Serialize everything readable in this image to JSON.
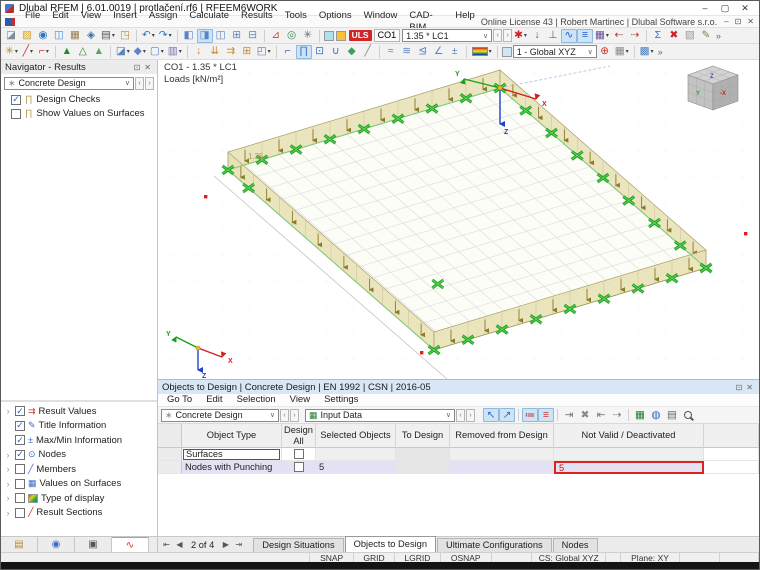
{
  "window": {
    "title": "Dlubal RFEM | 6.01.0019 | protlačení.rf6 | RFEEM6WORK",
    "license_text": "Online License 43 | Robert Martinec | Dlubal Software s.r.o."
  },
  "glyphs": {
    "minimize": "–",
    "maximize": "▢",
    "close": "✕",
    "pin": "⊡",
    "combo_chevron": "∨",
    "back": "‹",
    "fwd": "›",
    "overflow": "»",
    "nav_first": "⇤",
    "nav_prev": "◀",
    "nav_next": "▶",
    "nav_last": "⇥",
    "combo_leaf": "∗",
    "table_green": "▦"
  },
  "menubar": [
    "File",
    "Edit",
    "View",
    "Insert",
    "Assign",
    "Calculate",
    "Results",
    "Tools",
    "Options",
    "Window",
    "CAD-BIM",
    "Help"
  ],
  "toolbar1": {
    "uls": "ULS",
    "co": "CO1",
    "combo_value": "1.35 * LC1",
    "swatch1": "#aee0f0",
    "swatch2": "#f5c23a",
    "left": [
      {
        "name": "import-model-icon",
        "g": "◪",
        "c": "#7a8ca0"
      },
      {
        "name": "open-file-icon",
        "g": "▨",
        "c": "#d8a21d"
      },
      {
        "name": "sync-model-icon",
        "g": "◉",
        "c": "#2f74c0"
      },
      {
        "name": "copy-icon",
        "g": "◫",
        "c": "#4a90d9"
      },
      {
        "name": "archive-icon",
        "g": "▦",
        "c": "#9a7b4f"
      },
      {
        "name": "save-icon",
        "g": "◈",
        "c": "#3a6ea5"
      },
      {
        "name": "print-icon",
        "g": "▤",
        "c": "#555555",
        "dd": true
      },
      {
        "name": "paste-icon",
        "g": "◳",
        "c": "#b58b3a"
      },
      "|",
      {
        "name": "undo-icon",
        "g": "↶",
        "c": "#2f74c0",
        "dd": true
      },
      {
        "name": "redo-icon",
        "g": "↷",
        "c": "#2f74c0",
        "dd": true
      },
      "|",
      {
        "name": "navigator-toggle-icon",
        "g": "◧",
        "c": "#5b84c4"
      },
      {
        "name": "tables-toggle-icon",
        "g": "◨",
        "c": "#5b84c4",
        "t": true
      },
      {
        "name": "panel-toggle-icon",
        "g": "◫",
        "c": "#5b84c4"
      },
      {
        "name": "dual-view-icon",
        "g": "⊞",
        "c": "#5b84c4"
      },
      {
        "name": "table-view-icon",
        "g": "⊟",
        "c": "#5b84c4"
      },
      "|",
      {
        "name": "select-objects-icon",
        "g": "⊿",
        "c": "#c04a3a"
      },
      {
        "name": "visibility-states-icon",
        "g": "◎",
        "c": "#3a8a5a"
      },
      {
        "name": "display-settings-icon",
        "g": "✳",
        "c": "#6a6a6a"
      },
      "|"
    ],
    "right": [
      {
        "name": "result-filter-icon",
        "g": "✱",
        "c": "#cc2222",
        "dd": true
      },
      {
        "name": "show-loads-icon",
        "g": "↓",
        "c": "#2a7d2a"
      },
      {
        "name": "show-supports-icon",
        "g": "⊥",
        "c": "#666666"
      },
      {
        "name": "show-results-icon",
        "g": "∿",
        "c": "#2255cc",
        "t": true
      },
      {
        "name": "show-result-values-icon",
        "g": "≡",
        "c": "#2255cc",
        "t": true
      },
      {
        "name": "result-tables-icon",
        "g": "▦",
        "c": "#6a4a9a",
        "dd": true
      },
      {
        "name": "previous-loading-icon",
        "g": "⇠",
        "c": "#c03333"
      },
      {
        "name": "next-loading-icon",
        "g": "⇢",
        "c": "#c03333"
      },
      "|",
      {
        "name": "calculation-icon",
        "g": "Σ",
        "c": "#3a6bc4"
      },
      {
        "name": "clear-results-icon",
        "g": "✖",
        "c": "#cc2222"
      },
      {
        "name": "render-mode-icon",
        "g": "▧",
        "c": "#999999"
      },
      {
        "name": "edit-mode-icon",
        "g": "✎",
        "c": "#8a7a3a"
      }
    ]
  },
  "toolbar2": {
    "cs_value": "1 - Global XYZ",
    "cs_swatch": "#cfe6f5",
    "left": [
      {
        "name": "new-node-icon",
        "g": "✳",
        "c": "#b58b3a",
        "dd": true
      },
      {
        "name": "new-line-icon",
        "g": "╱",
        "c": "#cc3333",
        "dd": true
      },
      {
        "name": "new-polyline-icon",
        "g": "⌐",
        "c": "#cc3333",
        "dd": true
      },
      "|",
      {
        "name": "new-nodal-support-icon",
        "g": "▲",
        "c": "#2a8a2a"
      },
      {
        "name": "new-line-support-icon",
        "g": "△",
        "c": "#2a8a2a"
      },
      {
        "name": "support-table-icon",
        "g": "▲",
        "c": "#57a857"
      },
      "|",
      {
        "name": "new-surface-icon",
        "g": "◪",
        "c": "#5b84c4",
        "dd": true
      },
      {
        "name": "new-solid-icon",
        "g": "◆",
        "c": "#5b84c4",
        "dd": true
      },
      {
        "name": "new-opening-icon",
        "g": "▢",
        "c": "#5b84c4",
        "dd": true
      },
      {
        "name": "new-section-icon",
        "g": "▥",
        "c": "#7a6ab0",
        "dd": true
      },
      "|",
      {
        "name": "nodal-load-icon",
        "g": "↓",
        "c": "#cc8a2a"
      },
      {
        "name": "member-load-icon",
        "g": "⇊",
        "c": "#cc8a2a"
      },
      {
        "name": "surface-load-icon",
        "g": "⇉",
        "c": "#cc8a2a"
      },
      {
        "name": "free-load-icon",
        "g": "⊞",
        "c": "#cc8a2a"
      },
      {
        "name": "load-wizard-icon",
        "g": "◰",
        "c": "#7a6ab0",
        "dd": true
      },
      "|"
    ],
    "right": [
      {
        "name": "clip-plane-icon",
        "g": "⌐",
        "c": "#3a6bc4"
      },
      {
        "name": "wireframe-icon",
        "g": "∏",
        "c": "#3a6bc4",
        "t": true
      },
      {
        "name": "solid-display-icon",
        "g": "⊡",
        "c": "#3a6bc4"
      },
      {
        "name": "transparent-display-icon",
        "g": "∪",
        "c": "#3a6bc4"
      },
      {
        "name": "render-colors-icon",
        "g": "◆",
        "c": "#3aa05a"
      },
      {
        "name": "view-angle-icon",
        "g": "╱",
        "c": "#888888"
      },
      "|",
      {
        "name": "smooth-results-icon",
        "g": "≈",
        "c": "#5b84c4"
      },
      {
        "name": "hatch-results-icon",
        "g": "≋",
        "c": "#5b84c4"
      },
      {
        "name": "section-results-icon",
        "g": "⊴",
        "c": "#5b84c4"
      },
      {
        "name": "angle-icon",
        "g": "∠",
        "c": "#5b84c4"
      },
      {
        "name": "deform-scale-icon",
        "g": "±",
        "c": "#5b84c4"
      },
      "|",
      {
        "name": "color-scale-icon",
        "grad": true,
        "dd": true
      },
      "|"
    ],
    "right2": [
      {
        "name": "find-cs-icon",
        "g": "⊕",
        "c": "#cc3333"
      },
      {
        "name": "grid-settings-icon",
        "g": "▦",
        "c": "#888888",
        "dd": true
      },
      "|",
      {
        "name": "background-icon",
        "g": "▩",
        "c": "#4a7ebb",
        "dd": true
      }
    ]
  },
  "navigator": {
    "title": "Navigator - Results",
    "combo": "Concrete Design",
    "checks": [
      {
        "label": "Design Checks",
        "checked": true
      },
      {
        "label": "Show Values on Surfaces",
        "checked": false
      }
    ],
    "tree": [
      {
        "label": "Result Values",
        "checked": true,
        "expand": true,
        "glyph": "⇉",
        "color": "#cc3333"
      },
      {
        "label": "Title Information",
        "checked": true,
        "expand": false,
        "glyph": "✎",
        "color": "#3a6bc4"
      },
      {
        "label": "Max/Min Information",
        "checked": true,
        "expand": false,
        "glyph": "±",
        "color": "#3a6bc4"
      },
      {
        "label": "Nodes",
        "checked": true,
        "expand": true,
        "glyph": "⊙",
        "color": "#3a6bc4"
      },
      {
        "label": "Members",
        "checked": false,
        "expand": true,
        "glyph": "╱",
        "color": "#3a6bc4"
      },
      {
        "label": "Values on Surfaces",
        "checked": false,
        "expand": true,
        "glyph": "▦",
        "color": "#3a6bc4"
      },
      {
        "label": "Type of display",
        "checked": false,
        "expand": true,
        "glyph": "rainbow",
        "color": "rainbow"
      },
      {
        "label": "Result Sections",
        "checked": false,
        "expand": true,
        "glyph": "╱",
        "color": "#cc3333"
      }
    ],
    "bottom_tabs": [
      {
        "name": "navigator-data-tab",
        "glyph": "▤",
        "color": "#b5893a",
        "active": false
      },
      {
        "name": "navigator-display-tab",
        "glyph": "◉",
        "color": "#3a6bc4",
        "active": false
      },
      {
        "name": "navigator-views-tab",
        "glyph": "▣",
        "color": "#555555",
        "active": false
      },
      {
        "name": "navigator-results-tab",
        "glyph": "∿",
        "color": "#cc3333",
        "active": true
      }
    ]
  },
  "viewport": {
    "header_line1": "CO1 - 1.35 * LC1",
    "header_line2": "Loads [kN/m²]",
    "wall_load_value": "1.35",
    "axes": {
      "x": "X",
      "y": "Y",
      "z": "Z"
    },
    "cube": {
      "top": "Z",
      "left": "Y",
      "right": "-X"
    }
  },
  "panel": {
    "title": "Objects to Design | Concrete Design | EN 1992 | CSN | 2016-05",
    "menu": [
      "Go To",
      "Edit",
      "Selection",
      "View",
      "Settings"
    ],
    "combo1": "Concrete Design",
    "combo2": "Input Data",
    "toolbar_icons": [
      {
        "name": "select-in-graphic-icon",
        "g": "↖",
        "c": "#3a6bc4",
        "t": true
      },
      {
        "name": "sync-selection-icon",
        "g": "↗",
        "c": "#3a6bc4",
        "t": true
      },
      "|",
      {
        "name": "jump-to-row-icon",
        "g": "≔",
        "c": "#cc3333",
        "t": true
      },
      {
        "name": "filter-rows-icon",
        "g": "≡",
        "c": "#cc3333",
        "t": true
      },
      "|",
      {
        "name": "insert-row-icon",
        "g": "⇥",
        "c": "#777777"
      },
      {
        "name": "delete-row-icon",
        "g": "✖",
        "c": "#888888"
      },
      {
        "name": "import-table-icon",
        "g": "⇤",
        "c": "#777777"
      },
      {
        "name": "export-row-icon",
        "g": "⇢",
        "c": "#777777"
      },
      "|",
      {
        "name": "export-excel-icon",
        "g": "▦",
        "c": "#1e7e34"
      },
      {
        "name": "web-service-icon",
        "g": "◍",
        "c": "#2a6bc4"
      },
      {
        "name": "print-table-icon",
        "g": "▤",
        "c": "#666666"
      },
      {
        "name": "search-icon",
        "mag": true
      }
    ],
    "table": {
      "headers": [
        "Object Type",
        "Design\nAll",
        "Selected Objects",
        "To Design",
        "Removed from Design",
        "Not Valid / Deactivated"
      ],
      "rows": [
        {
          "object_type": "Surfaces",
          "design_all": false,
          "selected": "",
          "to_design": "",
          "removed": "",
          "not_valid": ""
        },
        {
          "object_type": "Nodes with Punching",
          "design_all": false,
          "selected": "5",
          "to_design": "",
          "removed": "",
          "not_valid": "5"
        }
      ]
    },
    "nav_position": "2 of 4",
    "tabs": [
      "Design Situations",
      "Objects to Design",
      "Ultimate Configurations",
      "Nodes"
    ],
    "active_tab": 1
  },
  "statusbar": {
    "snaps": [
      "SNAP",
      "GRID",
      "LGRID",
      "OSNAP"
    ],
    "cs": "CS: Global XYZ",
    "plane": "Plane: XY"
  }
}
